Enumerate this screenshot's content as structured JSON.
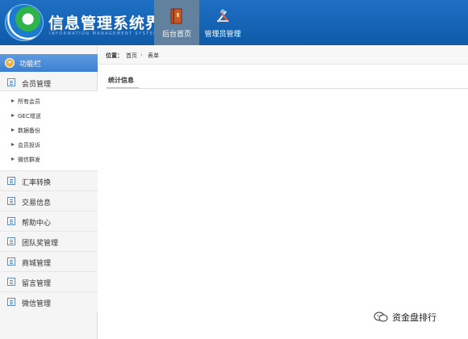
{
  "header": {
    "title": "信息管理系统界面",
    "subtitle": "INFORMATION MANAGEMENT SYSTEM GUI",
    "nav": [
      {
        "label": "后台首页",
        "icon": "book-icon",
        "active": true
      },
      {
        "label": "管理员管理",
        "icon": "admin-tools-icon",
        "active": false
      }
    ]
  },
  "sidebar": {
    "header_label": "功能栏",
    "group_label": "会员管理",
    "sub_items": [
      "所有会员",
      "GEC增送",
      "数据备份",
      "会员投诉",
      "微信群发"
    ],
    "menu_items": [
      "汇率转换",
      "交易信息",
      "帮助中心",
      "团队奖管理",
      "商城管理",
      "留言管理",
      "微信管理"
    ]
  },
  "breadcrumb": {
    "label": "位置：",
    "home": "首页",
    "separator": "›",
    "current": "表单"
  },
  "main": {
    "section_title": "统计信息"
  },
  "watermark": {
    "text": "资金盘排行"
  },
  "colors": {
    "header": "#1a68bd",
    "active_nav": "#62819f",
    "sidebar_head": "#4a8ad8"
  }
}
